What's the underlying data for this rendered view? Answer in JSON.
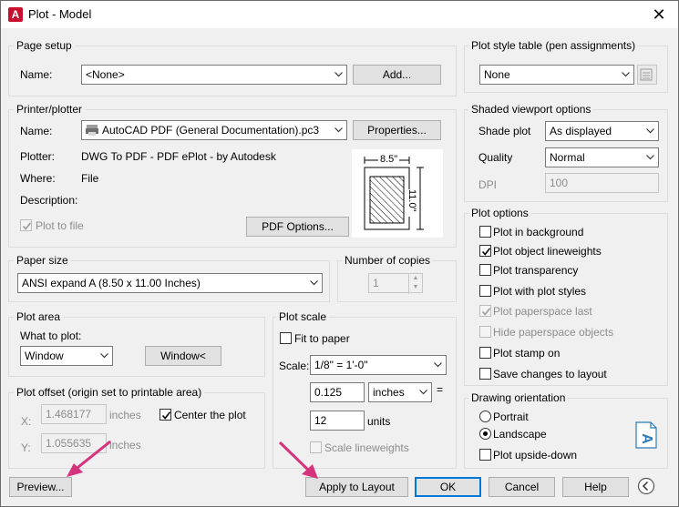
{
  "window": {
    "title": "Plot - Model",
    "app_icon": "A"
  },
  "page_setup": {
    "group_label": "Page setup",
    "name_label": "Name:",
    "name_value": "<None>",
    "add_button": "Add..."
  },
  "printer": {
    "group_label": "Printer/plotter",
    "name_label": "Name:",
    "name_value": "AutoCAD PDF (General Documentation).pc3",
    "properties_button": "Properties...",
    "plotter_label": "Plotter:",
    "plotter_value": "DWG To PDF - PDF ePlot - by Autodesk",
    "where_label": "Where:",
    "where_value": "File",
    "description_label": "Description:",
    "plot_to_file": "Plot to file",
    "pdf_options_button": "PDF Options...",
    "paper_width_label": "8.5\"",
    "paper_height_label": "11.0\""
  },
  "paper_size": {
    "group_label": "Paper size",
    "value": "ANSI expand A (8.50 x 11.00 Inches)"
  },
  "copies": {
    "group_label": "Number of copies",
    "value": "1"
  },
  "plot_area": {
    "group_label": "Plot area",
    "what_label": "What to plot:",
    "what_value": "Window",
    "window_button": "Window<"
  },
  "plot_offset": {
    "group_label": "Plot offset (origin set to printable area)",
    "x_label": "X:",
    "x_value": "1.468177",
    "x_unit": "inches",
    "y_label": "Y:",
    "y_value": "1.055635",
    "y_unit": "inches",
    "center_label": "Center the plot"
  },
  "plot_scale": {
    "group_label": "Plot scale",
    "fit_label": "Fit to paper",
    "scale_label": "Scale:",
    "scale_value": "1/8\" = 1'-0\"",
    "value1": "0.125",
    "unit1": "inches",
    "equals": "=",
    "value2": "12",
    "unit2": "units",
    "lineweights_label": "Scale lineweights"
  },
  "plot_style": {
    "group_label": "Plot style table (pen assignments)",
    "value": "None"
  },
  "shaded": {
    "group_label": "Shaded viewport options",
    "shade_label": "Shade plot",
    "shade_value": "As displayed",
    "quality_label": "Quality",
    "quality_value": "Normal",
    "dpi_label": "DPI",
    "dpi_value": "100"
  },
  "plot_options": {
    "group_label": "Plot options",
    "items": [
      {
        "label": "Plot in background",
        "checked": false,
        "enabled": true
      },
      {
        "label": "Plot object lineweights",
        "checked": true,
        "enabled": true
      },
      {
        "label": "Plot transparency",
        "checked": false,
        "enabled": true
      },
      {
        "label": "Plot with plot styles",
        "checked": false,
        "enabled": true
      },
      {
        "label": "Plot paperspace last",
        "checked": true,
        "enabled": false
      },
      {
        "label": "Hide paperspace objects",
        "checked": false,
        "enabled": false
      },
      {
        "label": "Plot stamp on",
        "checked": false,
        "enabled": true
      },
      {
        "label": "Save changes to layout",
        "checked": false,
        "enabled": true
      }
    ]
  },
  "orientation": {
    "group_label": "Drawing orientation",
    "portrait": "Portrait",
    "landscape": "Landscape",
    "upside_down": "Plot upside-down",
    "selected": "Landscape",
    "orientation_icon_letter": "A"
  },
  "footer": {
    "preview_button": "Preview...",
    "apply_button": "Apply to Layout",
    "ok_button": "OK",
    "cancel_button": "Cancel",
    "help_button": "Help"
  },
  "colors": {
    "accent": "#0078d7",
    "annotation_arrow": "#d6337f"
  }
}
